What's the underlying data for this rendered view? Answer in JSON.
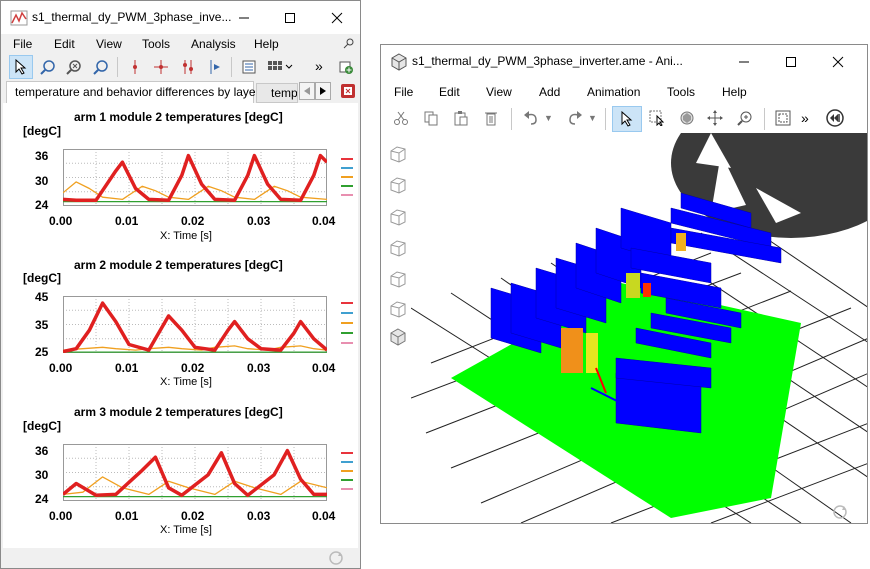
{
  "win1": {
    "title": "s1_thermal_dy_PWM_3phase_inve...",
    "menu": [
      "File",
      "Edit",
      "View",
      "Tools",
      "Analysis",
      "Help"
    ],
    "tabs": {
      "active": "temperature and behavior differences by layer",
      "next": "tempe"
    }
  },
  "win2": {
    "title": "s1_thermal_dy_PWM_3phase_inverter.ame - Ani...",
    "menu": [
      "File",
      "Edit",
      "View",
      "Add",
      "Animation",
      "Tools",
      "Help"
    ]
  },
  "plots": [
    {
      "title": "arm 1 module 2 temperatures [degC]",
      "unit": "[degC]",
      "yticks": [
        "36",
        "30",
        "24"
      ]
    },
    {
      "title": "arm 2 module 2 temperatures [degC]",
      "unit": "[degC]",
      "yticks": [
        "45",
        "35",
        "25"
      ]
    },
    {
      "title": "arm 3 module 2 temperatures [degC]",
      "unit": "[degC]",
      "yticks": [
        "36",
        "30",
        "24"
      ]
    }
  ],
  "xaxis": {
    "ticks": [
      "0.00",
      "0.01",
      "0.02",
      "0.03",
      "0.04"
    ],
    "label": "X: Time [s]"
  },
  "legend_colors": [
    "#e8343c",
    "#40a0d0",
    "#f0a020",
    "#30a030",
    "#e88fb0"
  ],
  "chart_data": [
    {
      "type": "line",
      "title": "arm 1 module 2 temperatures [degC]",
      "ylabel": "[degC]",
      "xlabel": "X: Time [s]",
      "xlim": [
        0,
        0.04
      ],
      "ylim": [
        24,
        37
      ],
      "series": [
        {
          "x": [
            0,
            0.002,
            0.005,
            0.008,
            0.009,
            0.011,
            0.013,
            0.016,
            0.018,
            0.019,
            0.021,
            0.023,
            0.026,
            0.028,
            0.029,
            0.031,
            0.033,
            0.036,
            0.038,
            0.039,
            0.04
          ],
          "values": [
            25.5,
            25.3,
            25.3,
            32,
            34,
            28,
            25.5,
            25.3,
            31,
            35.5,
            29,
            25.5,
            25.3,
            31,
            35.5,
            29,
            25.5,
            25.3,
            31,
            35.5,
            34
          ]
        },
        {
          "x": [
            0,
            0.002,
            0.004,
            0.006,
            0.009,
            0.012,
            0.014,
            0.016,
            0.019,
            0.022,
            0.024,
            0.026,
            0.029,
            0.032,
            0.034,
            0.036,
            0.04
          ],
          "values": [
            27,
            29.5,
            28,
            26,
            25.5,
            28.5,
            27.5,
            26,
            25.5,
            28.5,
            27.5,
            26,
            25.5,
            28.5,
            27.5,
            26,
            25.5
          ]
        },
        {
          "x": [
            0,
            0.04
          ],
          "values": [
            25,
            25
          ]
        }
      ]
    },
    {
      "type": "line",
      "title": "arm 2 module 2 temperatures [degC]",
      "ylabel": "[degC]",
      "xlabel": "X: Time [s]",
      "xlim": [
        0,
        0.04
      ],
      "ylim": [
        25,
        45
      ],
      "series": [
        {
          "x": [
            0,
            0.002,
            0.004,
            0.006,
            0.008,
            0.01,
            0.013,
            0.015,
            0.016,
            0.018,
            0.02,
            0.023,
            0.025,
            0.026,
            0.028,
            0.03,
            0.033,
            0.035,
            0.036,
            0.038,
            0.04
          ],
          "values": [
            25.5,
            26.5,
            33,
            42.5,
            36,
            28,
            26,
            34,
            38,
            33,
            27,
            26,
            33,
            36,
            30,
            26.5,
            26,
            32,
            36,
            30,
            26
          ]
        },
        {
          "x": [
            0,
            0.003,
            0.006,
            0.008,
            0.011,
            0.013,
            0.016,
            0.018,
            0.021,
            0.023,
            0.026,
            0.028,
            0.031,
            0.033,
            0.036,
            0.038,
            0.04
          ],
          "values": [
            26,
            26.5,
            27,
            26.5,
            26,
            26.5,
            27,
            26.5,
            26,
            27,
            27.5,
            26.5,
            26,
            27,
            27.5,
            26.5,
            26
          ]
        },
        {
          "x": [
            0,
            0.04
          ],
          "values": [
            25.3,
            25.3
          ]
        }
      ]
    },
    {
      "type": "line",
      "title": "arm 3 module 2 temperatures [degC]",
      "ylabel": "[degC]",
      "xlabel": "X: Time [s]",
      "xlim": [
        0,
        0.04
      ],
      "ylim": [
        24,
        37
      ],
      "series": [
        {
          "x": [
            0,
            0.002,
            0.005,
            0.008,
            0.012,
            0.014,
            0.016,
            0.018,
            0.022,
            0.024,
            0.026,
            0.028,
            0.032,
            0.034,
            0.036,
            0.038,
            0.04
          ],
          "values": [
            25.5,
            28,
            25.3,
            25.5,
            31,
            34,
            27,
            25.3,
            30,
            35,
            28,
            25.3,
            30,
            35.5,
            29,
            25.5,
            25.5
          ]
        },
        {
          "x": [
            0,
            0.003,
            0.006,
            0.009,
            0.013,
            0.016,
            0.019,
            0.023,
            0.026,
            0.029,
            0.033,
            0.036,
            0.04
          ],
          "values": [
            25.5,
            26,
            29.5,
            27,
            25.5,
            28.5,
            27,
            25.5,
            28.5,
            27,
            25.5,
            28.5,
            27
          ]
        },
        {
          "x": [
            0,
            0.04
          ],
          "values": [
            25,
            25
          ]
        }
      ]
    }
  ]
}
